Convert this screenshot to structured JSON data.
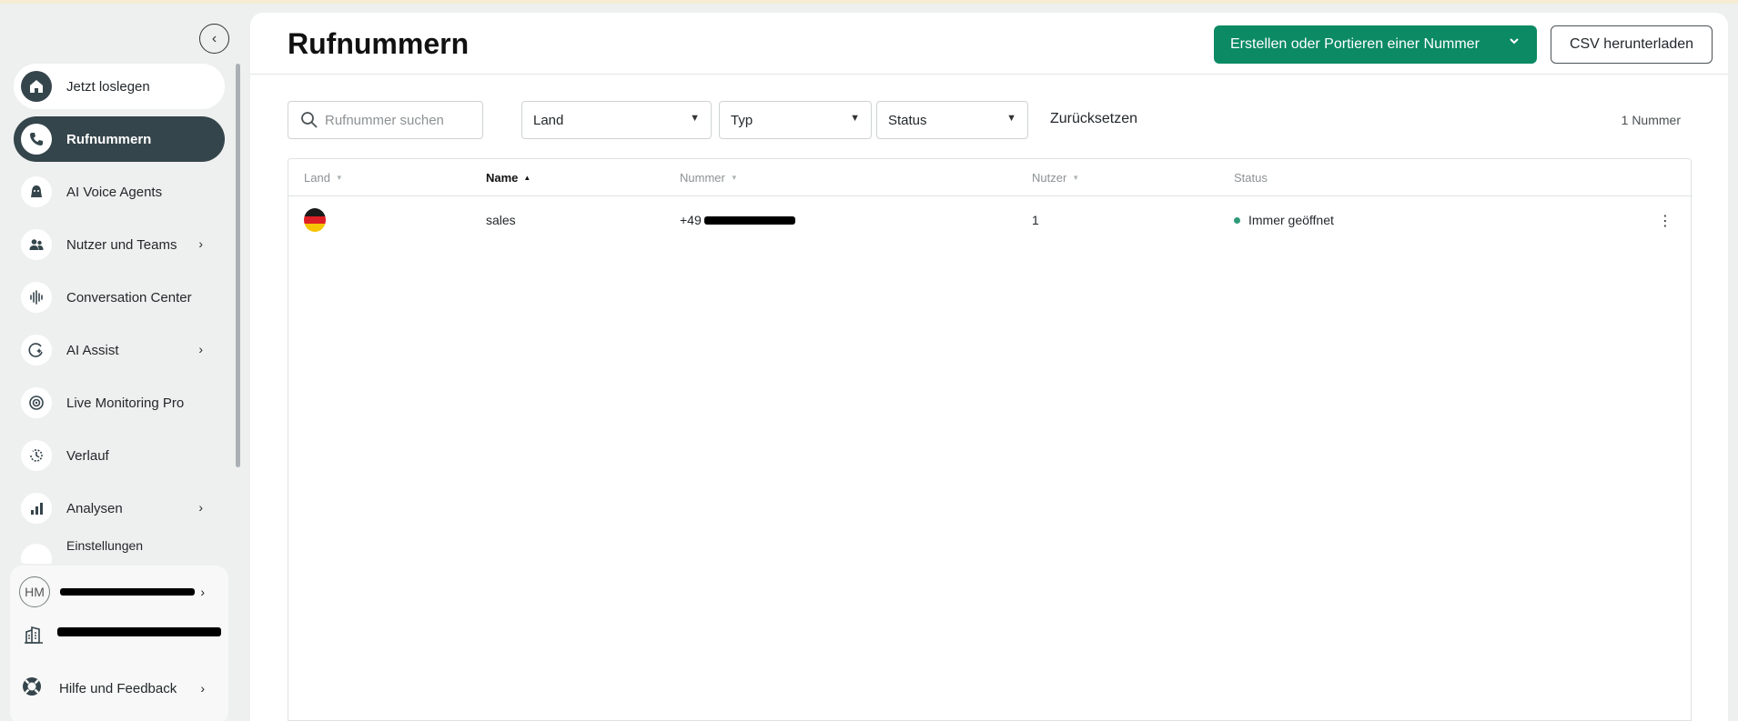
{
  "sidebar": {
    "collapse_icon": "chevron-left-icon",
    "items": [
      {
        "label": "Jetzt loslegen",
        "icon": "home-icon",
        "state": "home"
      },
      {
        "label": "Rufnummern",
        "icon": "phone-icon",
        "state": "active"
      },
      {
        "label": "AI Voice Agents",
        "icon": "ai-agent-icon"
      },
      {
        "label": "Nutzer und Teams",
        "icon": "users-icon",
        "has_submenu": true
      },
      {
        "label": "Conversation Center",
        "icon": "waveform-icon"
      },
      {
        "label": "AI Assist",
        "icon": "ai-assist-icon",
        "has_submenu": true
      },
      {
        "label": "Live Monitoring Pro",
        "icon": "live-monitoring-icon"
      },
      {
        "label": "Verlauf",
        "icon": "history-icon"
      },
      {
        "label": "Analysen",
        "icon": "chart-icon",
        "has_submenu": true
      },
      {
        "label": "Einstellungen",
        "icon": "settings-icon"
      }
    ],
    "user_panel": {
      "avatar_initials": "HM",
      "company_icon": "building-icon",
      "help_label": "Hilfe und Feedback"
    }
  },
  "main": {
    "title": "Rufnummern",
    "create_button": "Erstellen oder Portieren einer Nummer",
    "csv_button": "CSV herunterladen",
    "filters": {
      "search_placeholder": "Rufnummer suchen",
      "land": "Land",
      "typ": "Typ",
      "status": "Status",
      "reset": "Zurücksetzen"
    },
    "count": "1 Nummer",
    "table": {
      "columns": [
        "Land",
        "Name",
        "Nummer",
        "Nutzer",
        "Status"
      ],
      "sorted_column": "Name",
      "rows": [
        {
          "country": "DE",
          "name": "sales",
          "number_prefix": "+49",
          "users": "1",
          "status": "Immer geöffnet"
        }
      ]
    }
  },
  "colors": {
    "sidebar_active": "#35454c",
    "primary": "#0b8a64",
    "status_open": "#2f9a78"
  }
}
